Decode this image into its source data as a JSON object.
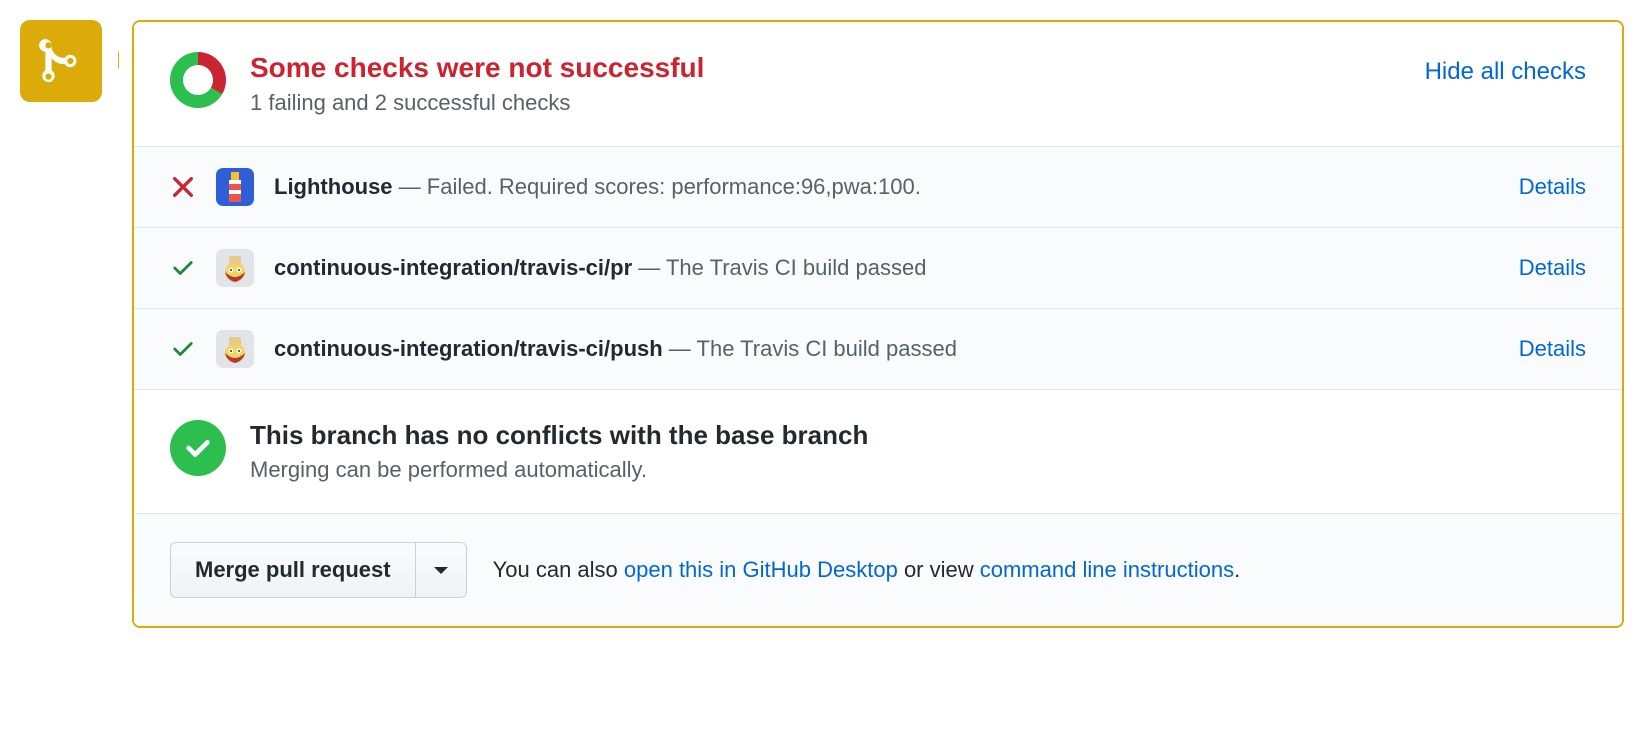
{
  "header": {
    "title": "Some checks were not successful",
    "subtitle": "1 failing and 2 successful checks",
    "hide_link": "Hide all checks"
  },
  "checks": [
    {
      "status": "fail",
      "avatar": "lighthouse",
      "name": "Lighthouse",
      "message": " — Failed. Required scores: performance:96,pwa:100.",
      "action": "Details"
    },
    {
      "status": "pass",
      "avatar": "travis",
      "name": "continuous-integration/travis-ci/pr",
      "message": " — The Travis CI build passed",
      "action": "Details"
    },
    {
      "status": "pass",
      "avatar": "travis",
      "name": "continuous-integration/travis-ci/push",
      "message": " — The Travis CI build passed",
      "action": "Details"
    }
  ],
  "conflicts": {
    "title": "This branch has no conflicts with the base branch",
    "subtitle": "Merging can be performed automatically."
  },
  "footer": {
    "merge_button": "Merge pull request",
    "lead_text": "You can also ",
    "desktop_link": "open this in GitHub Desktop",
    "mid_text": " or view ",
    "cli_link": "command line instructions",
    "trail_text": "."
  }
}
